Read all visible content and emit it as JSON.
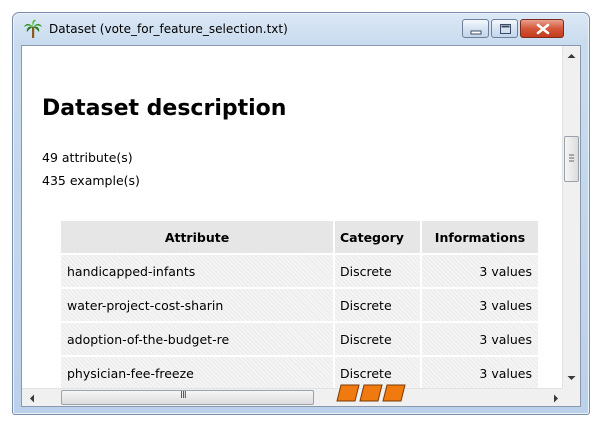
{
  "window": {
    "title": "Dataset (vote_for_feature_selection.txt)",
    "icon": "palm-tree-icon"
  },
  "content": {
    "heading": "Dataset description",
    "attribute_count": "49 attribute(s)",
    "example_count": "435 example(s)"
  },
  "table": {
    "headers": {
      "attribute": "Attribute",
      "category": "Category",
      "informations": "Informations"
    },
    "rows": [
      {
        "attribute": "handicapped-infants",
        "category": "Discrete",
        "informations": "3 values"
      },
      {
        "attribute": "water-project-cost-sharin",
        "category": "Discrete",
        "informations": "3 values"
      },
      {
        "attribute": "adoption-of-the-budget-re",
        "category": "Discrete",
        "informations": "3 values"
      },
      {
        "attribute": "physician-fee-freeze",
        "category": "Discrete",
        "informations": "3 values"
      }
    ]
  },
  "scrollbar": {
    "thumb_grip": "III"
  },
  "busy_indicator": {
    "color": "#f07a10",
    "segments": 3
  }
}
